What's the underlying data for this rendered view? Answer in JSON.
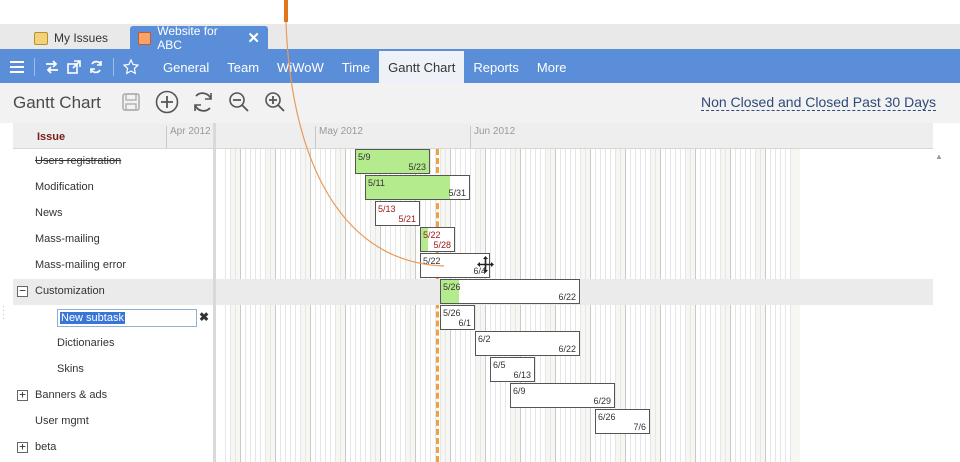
{
  "tabs": [
    {
      "label": "My Issues",
      "active": false
    },
    {
      "label": "Website for ABC",
      "active": true,
      "close_glyph": "✕"
    }
  ],
  "menubar": {
    "icons": [
      "menu-icon",
      "swap-icon",
      "open-new-icon",
      "refresh-icon",
      "star-icon"
    ],
    "items": [
      "General",
      "Team",
      "WiWoW",
      "Time",
      "Gantt Chart",
      "Reports",
      "More"
    ],
    "active": "Gantt Chart"
  },
  "titlebar": {
    "title": "Gantt Chart",
    "toolbar_icons": [
      "save-icon",
      "add-icon",
      "refresh-icon",
      "zoom-out-icon",
      "zoom-in-icon"
    ],
    "filter": "Non Closed and Closed Past 30 Days"
  },
  "grid": {
    "issue_header": "Issue",
    "months": [
      "Apr 2012",
      "May 2012",
      "Jun 2012"
    ],
    "rows": [
      {
        "label": "Users registration",
        "strike": true
      },
      {
        "label": "Modification"
      },
      {
        "label": "News"
      },
      {
        "label": "Mass-mailing"
      },
      {
        "label": "Mass-mailing error"
      },
      {
        "label": "Customization",
        "expander": "minus",
        "selected": true
      },
      {
        "label": "New subtask",
        "editing": true
      },
      {
        "label": "Dictionaries",
        "indent": true
      },
      {
        "label": "Skins",
        "indent": true
      },
      {
        "label": "Banners & ads",
        "expander": "plus"
      },
      {
        "label": "User mgmt"
      },
      {
        "label": "beta",
        "expander": "plus"
      }
    ],
    "bars": [
      {
        "start": "5/9",
        "end": "5/23",
        "progress": 1.0
      },
      {
        "start": "5/11",
        "end": "5/31",
        "progress": 0.82
      },
      {
        "start": "5/13",
        "end": "5/21",
        "progress": 0,
        "late": true
      },
      {
        "start": "5/22",
        "end": "5/28",
        "progress": 0.2,
        "late": true
      },
      {
        "start": "5/22",
        "end": "6/4",
        "progress": 0
      },
      {
        "start": "5/26",
        "end": "6/22",
        "progress": 0.13
      },
      {
        "start": "5/26",
        "end": "6/1",
        "progress": 0
      },
      {
        "start": "6/2",
        "end": "6/22",
        "progress": 0
      },
      {
        "start": "6/5",
        "end": "6/13",
        "progress": 0
      },
      {
        "start": "6/9",
        "end": "6/29",
        "progress": 0
      },
      {
        "start": "6/26",
        "end": "7/6",
        "progress": 0
      }
    ]
  },
  "colors": {
    "accent": "#5b8ed8",
    "progress_fill": "#b4eb8c",
    "today_line": "#f0a040",
    "late_text": "#a01818"
  }
}
